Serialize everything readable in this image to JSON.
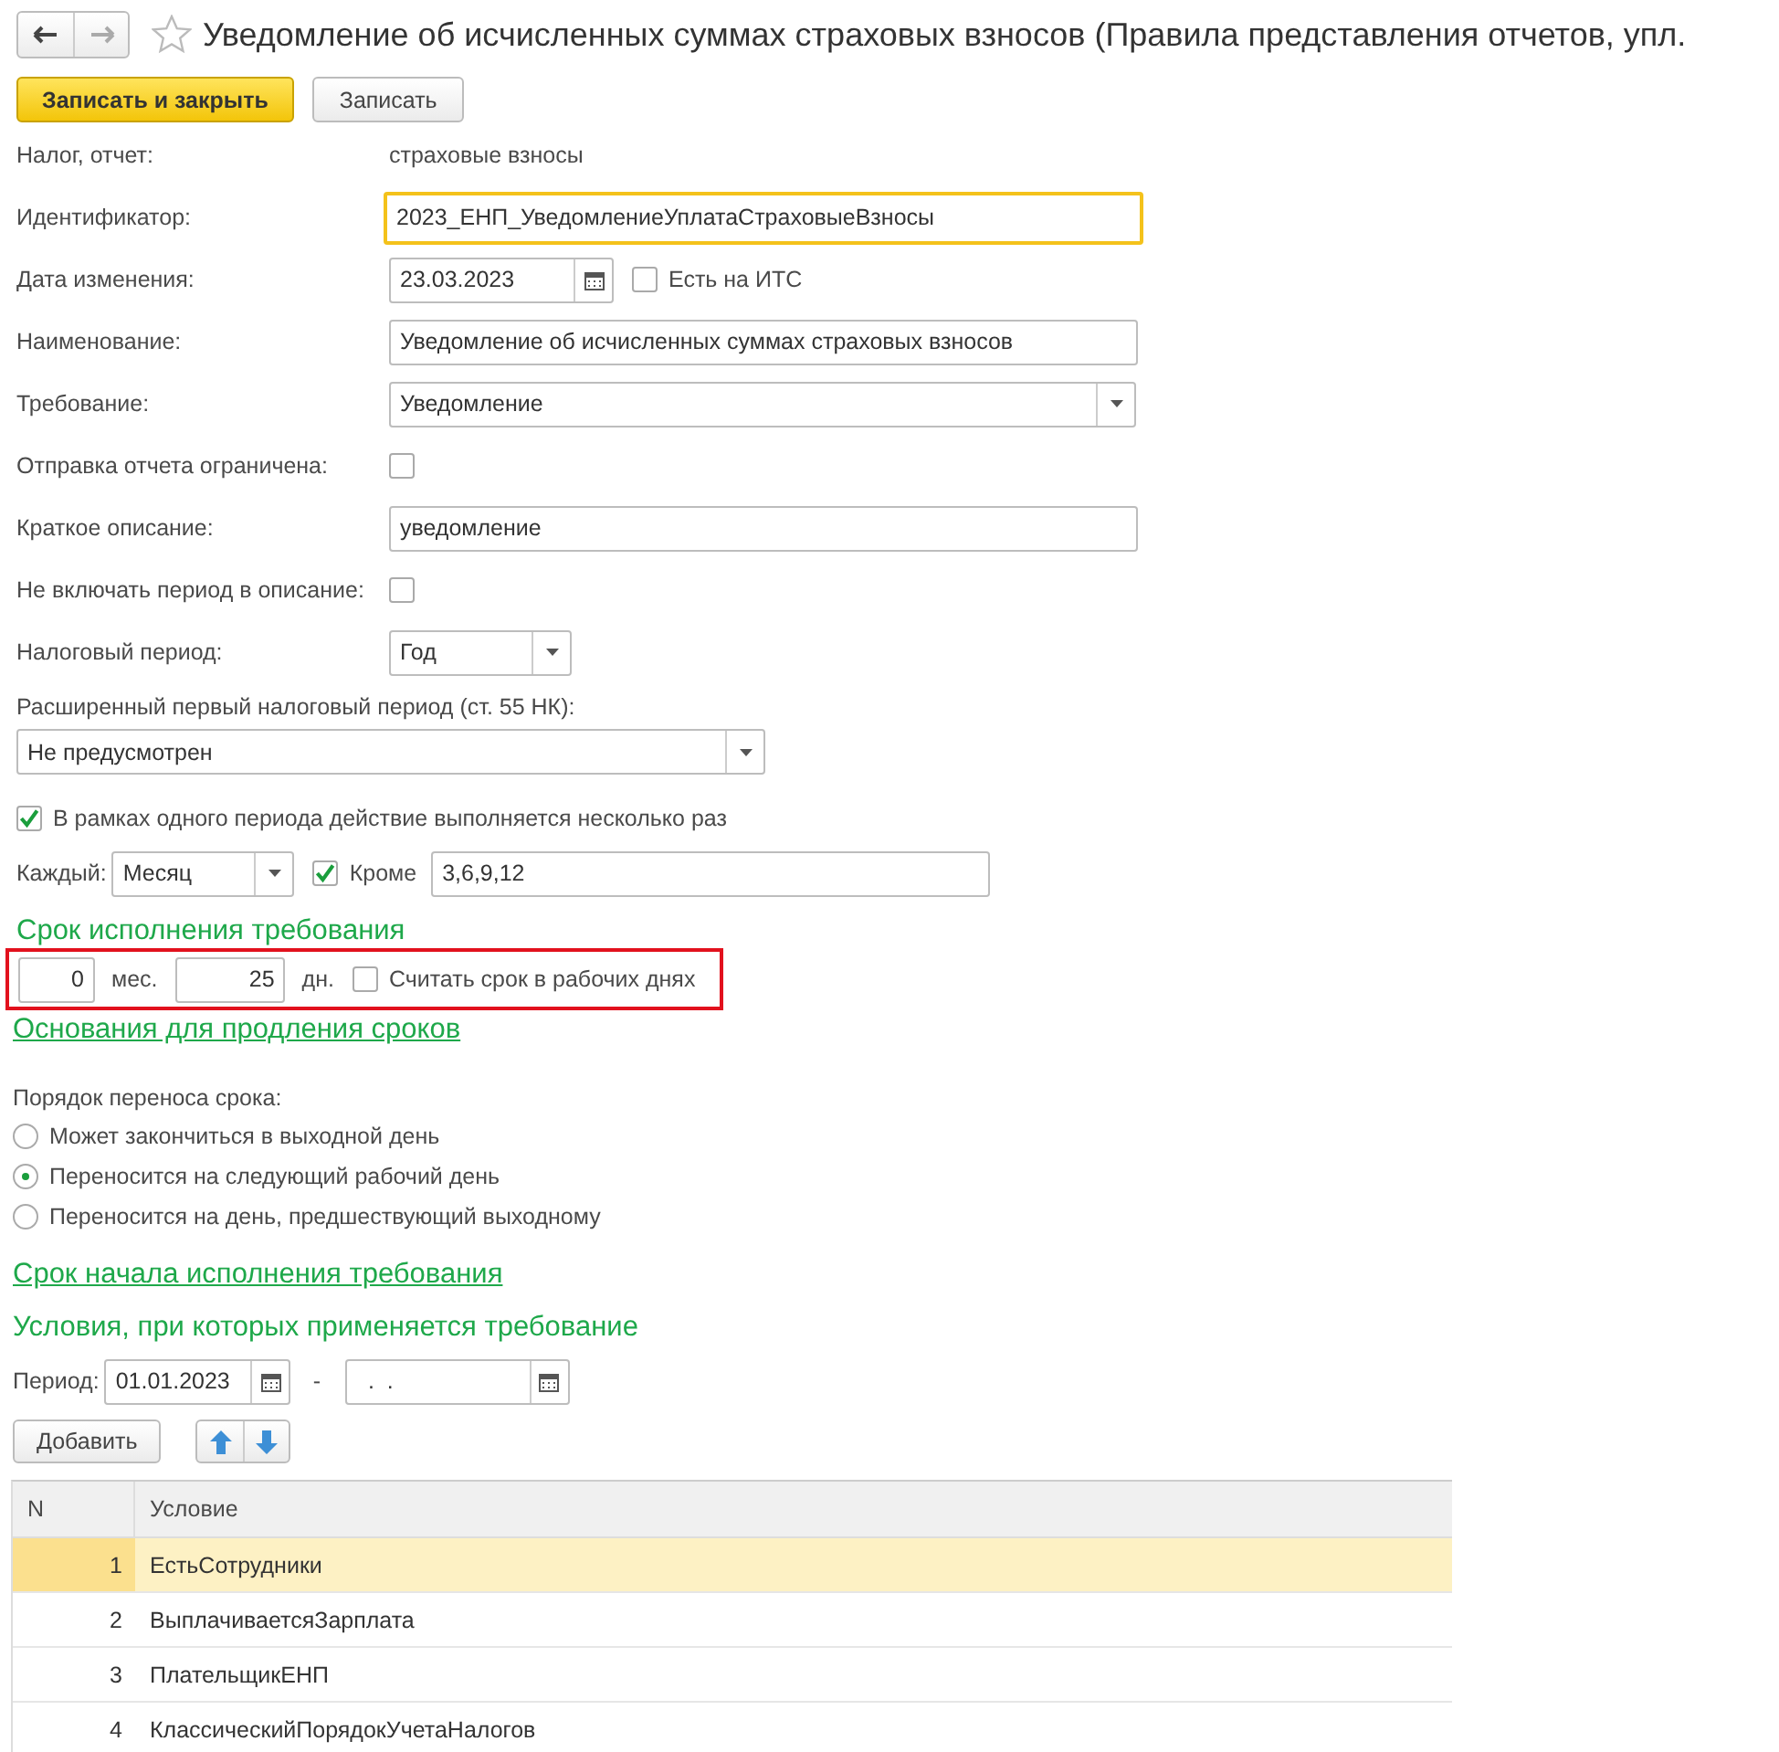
{
  "window": {
    "title": "Уведомление об исчисленных суммах страховых взносов (Правила представления отчетов, упл."
  },
  "toolbar": {
    "buttons": [
      {
        "label": "Записать и закрыть",
        "kind": "primary"
      },
      {
        "label": "Записать",
        "kind": "plain"
      }
    ]
  },
  "fields": [
    {
      "label": "Налог, отчет:",
      "kind": "text",
      "value": "страховые взносы"
    },
    {
      "label": "Идентификатор:",
      "kind": "input",
      "value": "2023_ЕНП_УведомлениеУплатаСтраховыеВзносы",
      "focused": true
    },
    {
      "label": "Дата изменения:",
      "kind": "date",
      "value": "23.03.2023",
      "extra_checkbox": {
        "label": "Есть на ИТС",
        "checked": false
      }
    },
    {
      "label": "Наименование:",
      "kind": "input",
      "value": "Уведомление об исчисленных суммах страховых взносов",
      "focused": false
    },
    {
      "label": "Требование:",
      "kind": "dropdown",
      "value": "Уведомление"
    },
    {
      "label": "Отправка отчета ограничена:",
      "kind": "checkbox",
      "checked": false
    },
    {
      "label": "Краткое описание:",
      "kind": "input",
      "value": "уведомление",
      "focused": false
    },
    {
      "label": "Не включать период в описание:",
      "kind": "checkbox",
      "checked": false
    },
    {
      "label": "Налоговый период:",
      "kind": "short_dropdown",
      "value": "Год"
    }
  ],
  "extended_period": {
    "label": "Расширенный первый налоговый период (ст. 55 НК):",
    "value": "Не предусмотрен"
  },
  "repeat": {
    "label": "В рамках одного периода действие выполняется несколько раз",
    "checked": true,
    "every_label": "Каждый:",
    "every_value": "Месяц",
    "except": {
      "label": "Кроме",
      "checked": true,
      "value": "3,6,9,12"
    }
  },
  "deadline": {
    "title": "Срок исполнения требования",
    "highlighted": true,
    "months": "0",
    "months_unit": "мес.",
    "days": "25",
    "days_unit": "дн.",
    "working_days": {
      "label": "Считать срок в рабочих днях",
      "checked": false
    }
  },
  "extension_link": "Основания для продления сроков",
  "transfer": {
    "label": "Порядок переноса срока:",
    "options": [
      {
        "label": "Может закончиться в выходной день",
        "selected": false
      },
      {
        "label": "Переносится на следующий рабочий день",
        "selected": true
      },
      {
        "label": "Переносится на день, предшествующий выходному",
        "selected": false
      }
    ]
  },
  "start_link": "Срок начала исполнения требования",
  "conditions": {
    "title": "Условия, при которых применяется требование",
    "period_label": "Период:",
    "period_from": "01.01.2023",
    "period_separator": "-",
    "period_to": "  .  .",
    "add_button": "Добавить",
    "table": {
      "columns": [
        "N",
        "Условие"
      ],
      "rows": [
        {
          "n": "1",
          "condition": "ЕстьСотрудники",
          "selected": true
        },
        {
          "n": "2",
          "condition": "ВыплачиваетсяЗарплата",
          "selected": false
        },
        {
          "n": "3",
          "condition": "ПлательщикЕНП",
          "selected": false
        },
        {
          "n": "4",
          "condition": "КлассическийПорядокУчетаНалогов",
          "selected": false
        }
      ]
    }
  }
}
